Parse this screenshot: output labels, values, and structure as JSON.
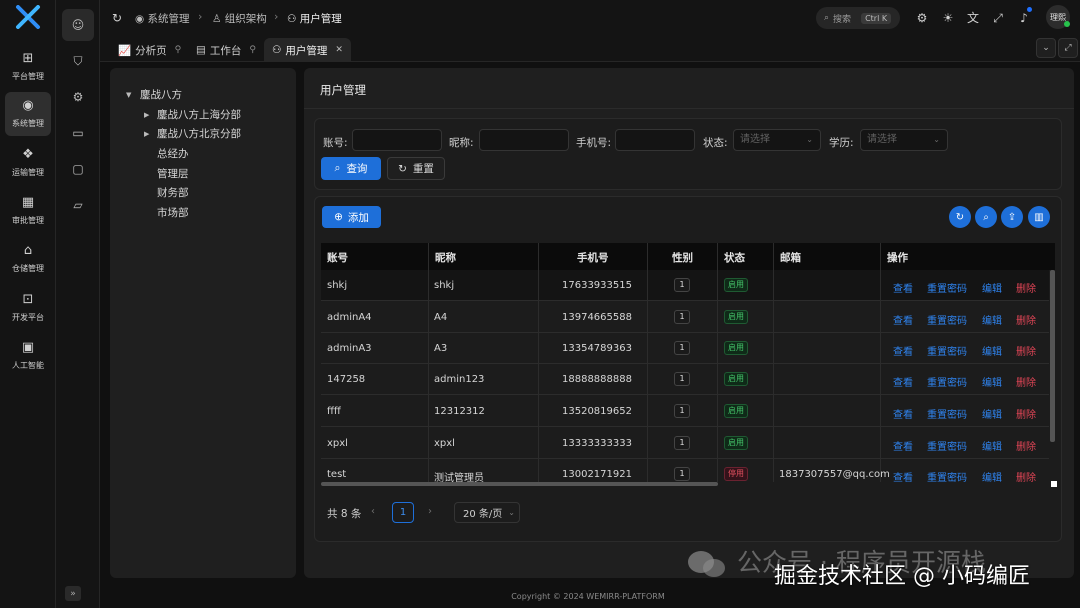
{
  "sidebar": {
    "items": [
      {
        "label": "平台管理",
        "icon": "platform-icon"
      },
      {
        "label": "系统管理",
        "icon": "system-icon",
        "active": true
      },
      {
        "label": "运输管理",
        "icon": "transport-icon"
      },
      {
        "label": "审批管理",
        "icon": "approval-icon"
      },
      {
        "label": "仓储管理",
        "icon": "warehouse-icon"
      },
      {
        "label": "开发平台",
        "icon": "dev-icon"
      },
      {
        "label": "人工智能",
        "icon": "ai-icon"
      }
    ]
  },
  "breadcrumb": {
    "items": [
      "系统管理",
      "组织架构",
      "用户管理"
    ]
  },
  "header": {
    "search_label": "搜索",
    "search_shortcut": "Ctrl K",
    "avatar_text": "理熙"
  },
  "tabs": {
    "items": [
      "分析页",
      "工作台",
      "用户管理"
    ]
  },
  "tree": {
    "root": "鏖战八方",
    "children": [
      "鏖战八方上海分部",
      "鏖战八方北京分部",
      "总经办",
      "管理层",
      "财务部",
      "市场部"
    ]
  },
  "panel": {
    "title": "用户管理"
  },
  "filters": {
    "account_label": "账号:",
    "nickname_label": "昵称:",
    "phone_label": "手机号:",
    "status_label": "状态:",
    "status_placeholder": "请选择",
    "edu_label": "学历:",
    "edu_placeholder": "请选择",
    "query_label": "查询",
    "reset_label": "重置"
  },
  "toolbar": {
    "add_label": "添加"
  },
  "table": {
    "headers": [
      "账号",
      "昵称",
      "手机号",
      "性别",
      "状态",
      "邮箱",
      "操作"
    ],
    "actions": [
      "查看",
      "重置密码",
      "编辑",
      "删除"
    ],
    "rows": [
      {
        "account": "shkj",
        "nickname": "shkj",
        "phone": "17633933515",
        "sex": "1",
        "status": "启用",
        "email": ""
      },
      {
        "account": "adminA4",
        "nickname": "A4",
        "phone": "13974665588",
        "sex": "1",
        "status": "启用",
        "email": ""
      },
      {
        "account": "adminA3",
        "nickname": "A3",
        "phone": "13354789363",
        "sex": "1",
        "status": "启用",
        "email": ""
      },
      {
        "account": "147258",
        "nickname": "admin123",
        "phone": "18888888888",
        "sex": "1",
        "status": "启用",
        "email": ""
      },
      {
        "account": "ffff",
        "nickname": "12312312",
        "phone": "13520819652",
        "sex": "1",
        "status": "启用",
        "email": ""
      },
      {
        "account": "xpxl",
        "nickname": "xpxl",
        "phone": "13333333333",
        "sex": "1",
        "status": "启用",
        "email": ""
      },
      {
        "account": "test",
        "nickname": "测试管理员",
        "phone": "13002171921",
        "sex": "1",
        "status": "停用",
        "email": "1837307557@qq.com"
      }
    ]
  },
  "pagination": {
    "total": "共 8 条",
    "page": "1",
    "page_size": "20 条/页"
  },
  "footer": {
    "copyright": "Copyright © 2024 WEMIRR-PLATFORM"
  },
  "watermark": {
    "line1": "公众号 · 程序员开源栈",
    "line2": "掘金技术社区 @ 小码编匠"
  },
  "colors": {
    "primary": "#1e6fd9",
    "link": "#2f84f0",
    "danger": "#e04556",
    "success": "#45c46a"
  }
}
